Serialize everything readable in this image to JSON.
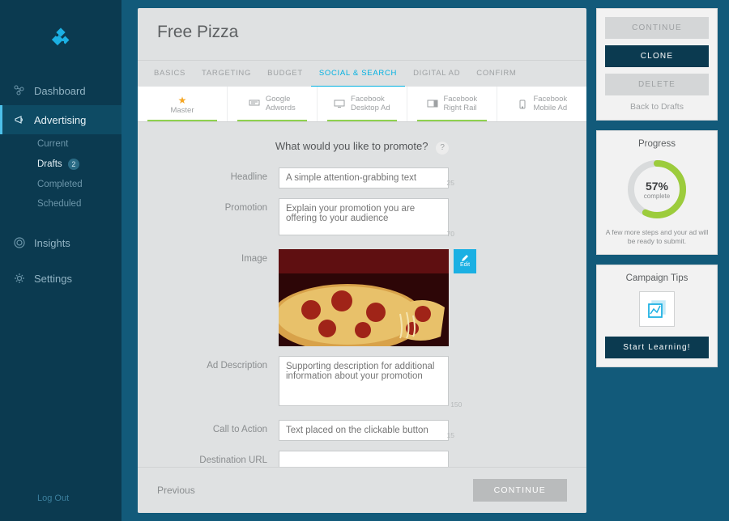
{
  "sidebar": {
    "items": [
      {
        "label": "Dashboard"
      },
      {
        "label": "Advertising"
      },
      {
        "label": "Insights"
      },
      {
        "label": "Settings"
      }
    ],
    "adv_sub": [
      {
        "label": "Current"
      },
      {
        "label": "Drafts",
        "badge": "2"
      },
      {
        "label": "Completed"
      },
      {
        "label": "Scheduled"
      }
    ],
    "logout": "Log Out"
  },
  "page": {
    "title": "Free Pizza",
    "steps": [
      "BASICS",
      "TARGETING",
      "BUDGET",
      "SOCIAL & SEARCH",
      "DIGITAL AD",
      "CONFIRM"
    ],
    "active_step": 3,
    "subtabs": [
      {
        "icon": "star",
        "l1": "Master",
        "l2": "",
        "cls": "master underline"
      },
      {
        "icon": "goog",
        "l1": "Google",
        "l2": "Adwords",
        "cls": "underline"
      },
      {
        "icon": "screen",
        "l1": "Facebook",
        "l2": "Desktop Ad",
        "cls": "underline"
      },
      {
        "icon": "rail",
        "l1": "Facebook",
        "l2": "Right Rail",
        "cls": "underline"
      },
      {
        "icon": "mobile",
        "l1": "Facebook",
        "l2": "Mobile Ad",
        "cls": ""
      }
    ],
    "prompt": "What would you like to promote?",
    "fields": {
      "headline": {
        "label": "Headline",
        "placeholder": "A simple attention-grabbing text",
        "limit": "25"
      },
      "promotion": {
        "label": "Promotion",
        "placeholder": "Explain your promotion you are offering to your audience",
        "limit": "70"
      },
      "image": {
        "label": "Image",
        "edit": "Edit"
      },
      "desc": {
        "label": "Ad Description",
        "placeholder": "Supporting description for additional information about your promotion",
        "limit": "150"
      },
      "cta": {
        "label": "Call to Action",
        "placeholder": "Text placed on the clickable button",
        "limit": "15"
      },
      "url": {
        "label": "Destination URL"
      }
    },
    "footer": {
      "prev": "Previous",
      "cont": "CONTINUE"
    }
  },
  "right": {
    "actions": {
      "continue": "CONTINUE",
      "clone": "CLONE",
      "delete": "DELETE",
      "back": "Back to Drafts"
    },
    "progress": {
      "title": "Progress",
      "pct": "57%",
      "label": "complete",
      "note": "A few more steps and your ad will be ready to submit."
    },
    "tips": {
      "title": "Campaign Tips",
      "button": "Start Learning!"
    }
  }
}
